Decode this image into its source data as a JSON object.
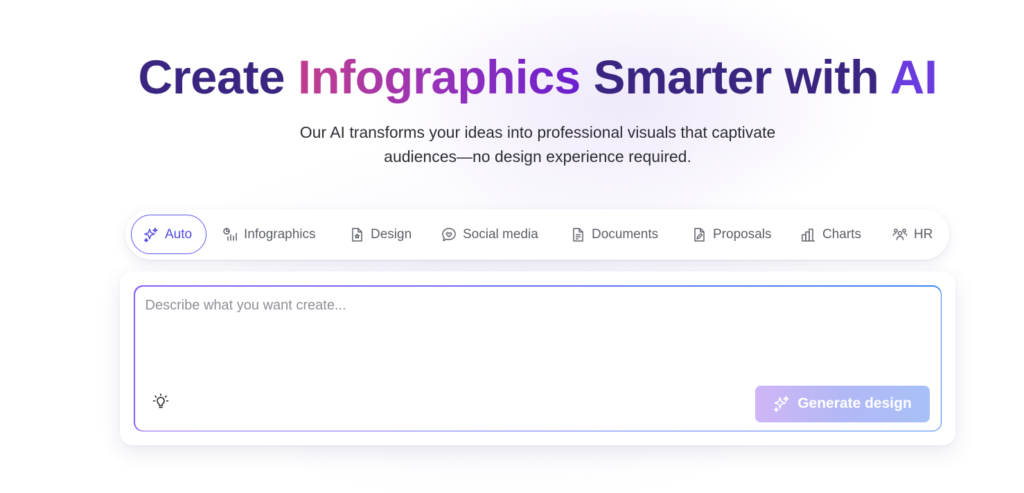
{
  "hero": {
    "title_part1": "Create",
    "title_part2": "Infographics",
    "title_part3": "Smarter with",
    "title_part4": "AI",
    "subtitle_line1": "Our AI transforms your ideas into professional visuals that captivate",
    "subtitle_line2": "audiences—no design experience required."
  },
  "tabs": [
    {
      "label": "Auto",
      "icon": "sparkles-icon",
      "active": true
    },
    {
      "label": "Infographics",
      "icon": "infographics-icon",
      "active": false
    },
    {
      "label": "Design",
      "icon": "design-file-icon",
      "active": false
    },
    {
      "label": "Social media",
      "icon": "chat-heart-icon",
      "active": false
    },
    {
      "label": "Documents",
      "icon": "document-icon",
      "active": false
    },
    {
      "label": "Proposals",
      "icon": "proposal-pen-icon",
      "active": false
    },
    {
      "label": "Charts",
      "icon": "bar-chart-icon",
      "active": false
    },
    {
      "label": "HR",
      "icon": "people-icon",
      "active": false
    }
  ],
  "prompt": {
    "placeholder": "Describe what you want create...",
    "value": "",
    "idea_icon": "lightbulb-icon",
    "generate_label": "Generate design",
    "generate_icon": "sparkles-icon"
  },
  "colors": {
    "title_dark": "#3a2580",
    "title_gradient_start": "#c23d8c",
    "title_gradient_end": "#6a1fcf",
    "title_ai": "#6a3cdf",
    "active_tab": "#5148e0",
    "generate_gradient_start": "#cfb6f6",
    "generate_gradient_end": "#a8c0f7"
  }
}
